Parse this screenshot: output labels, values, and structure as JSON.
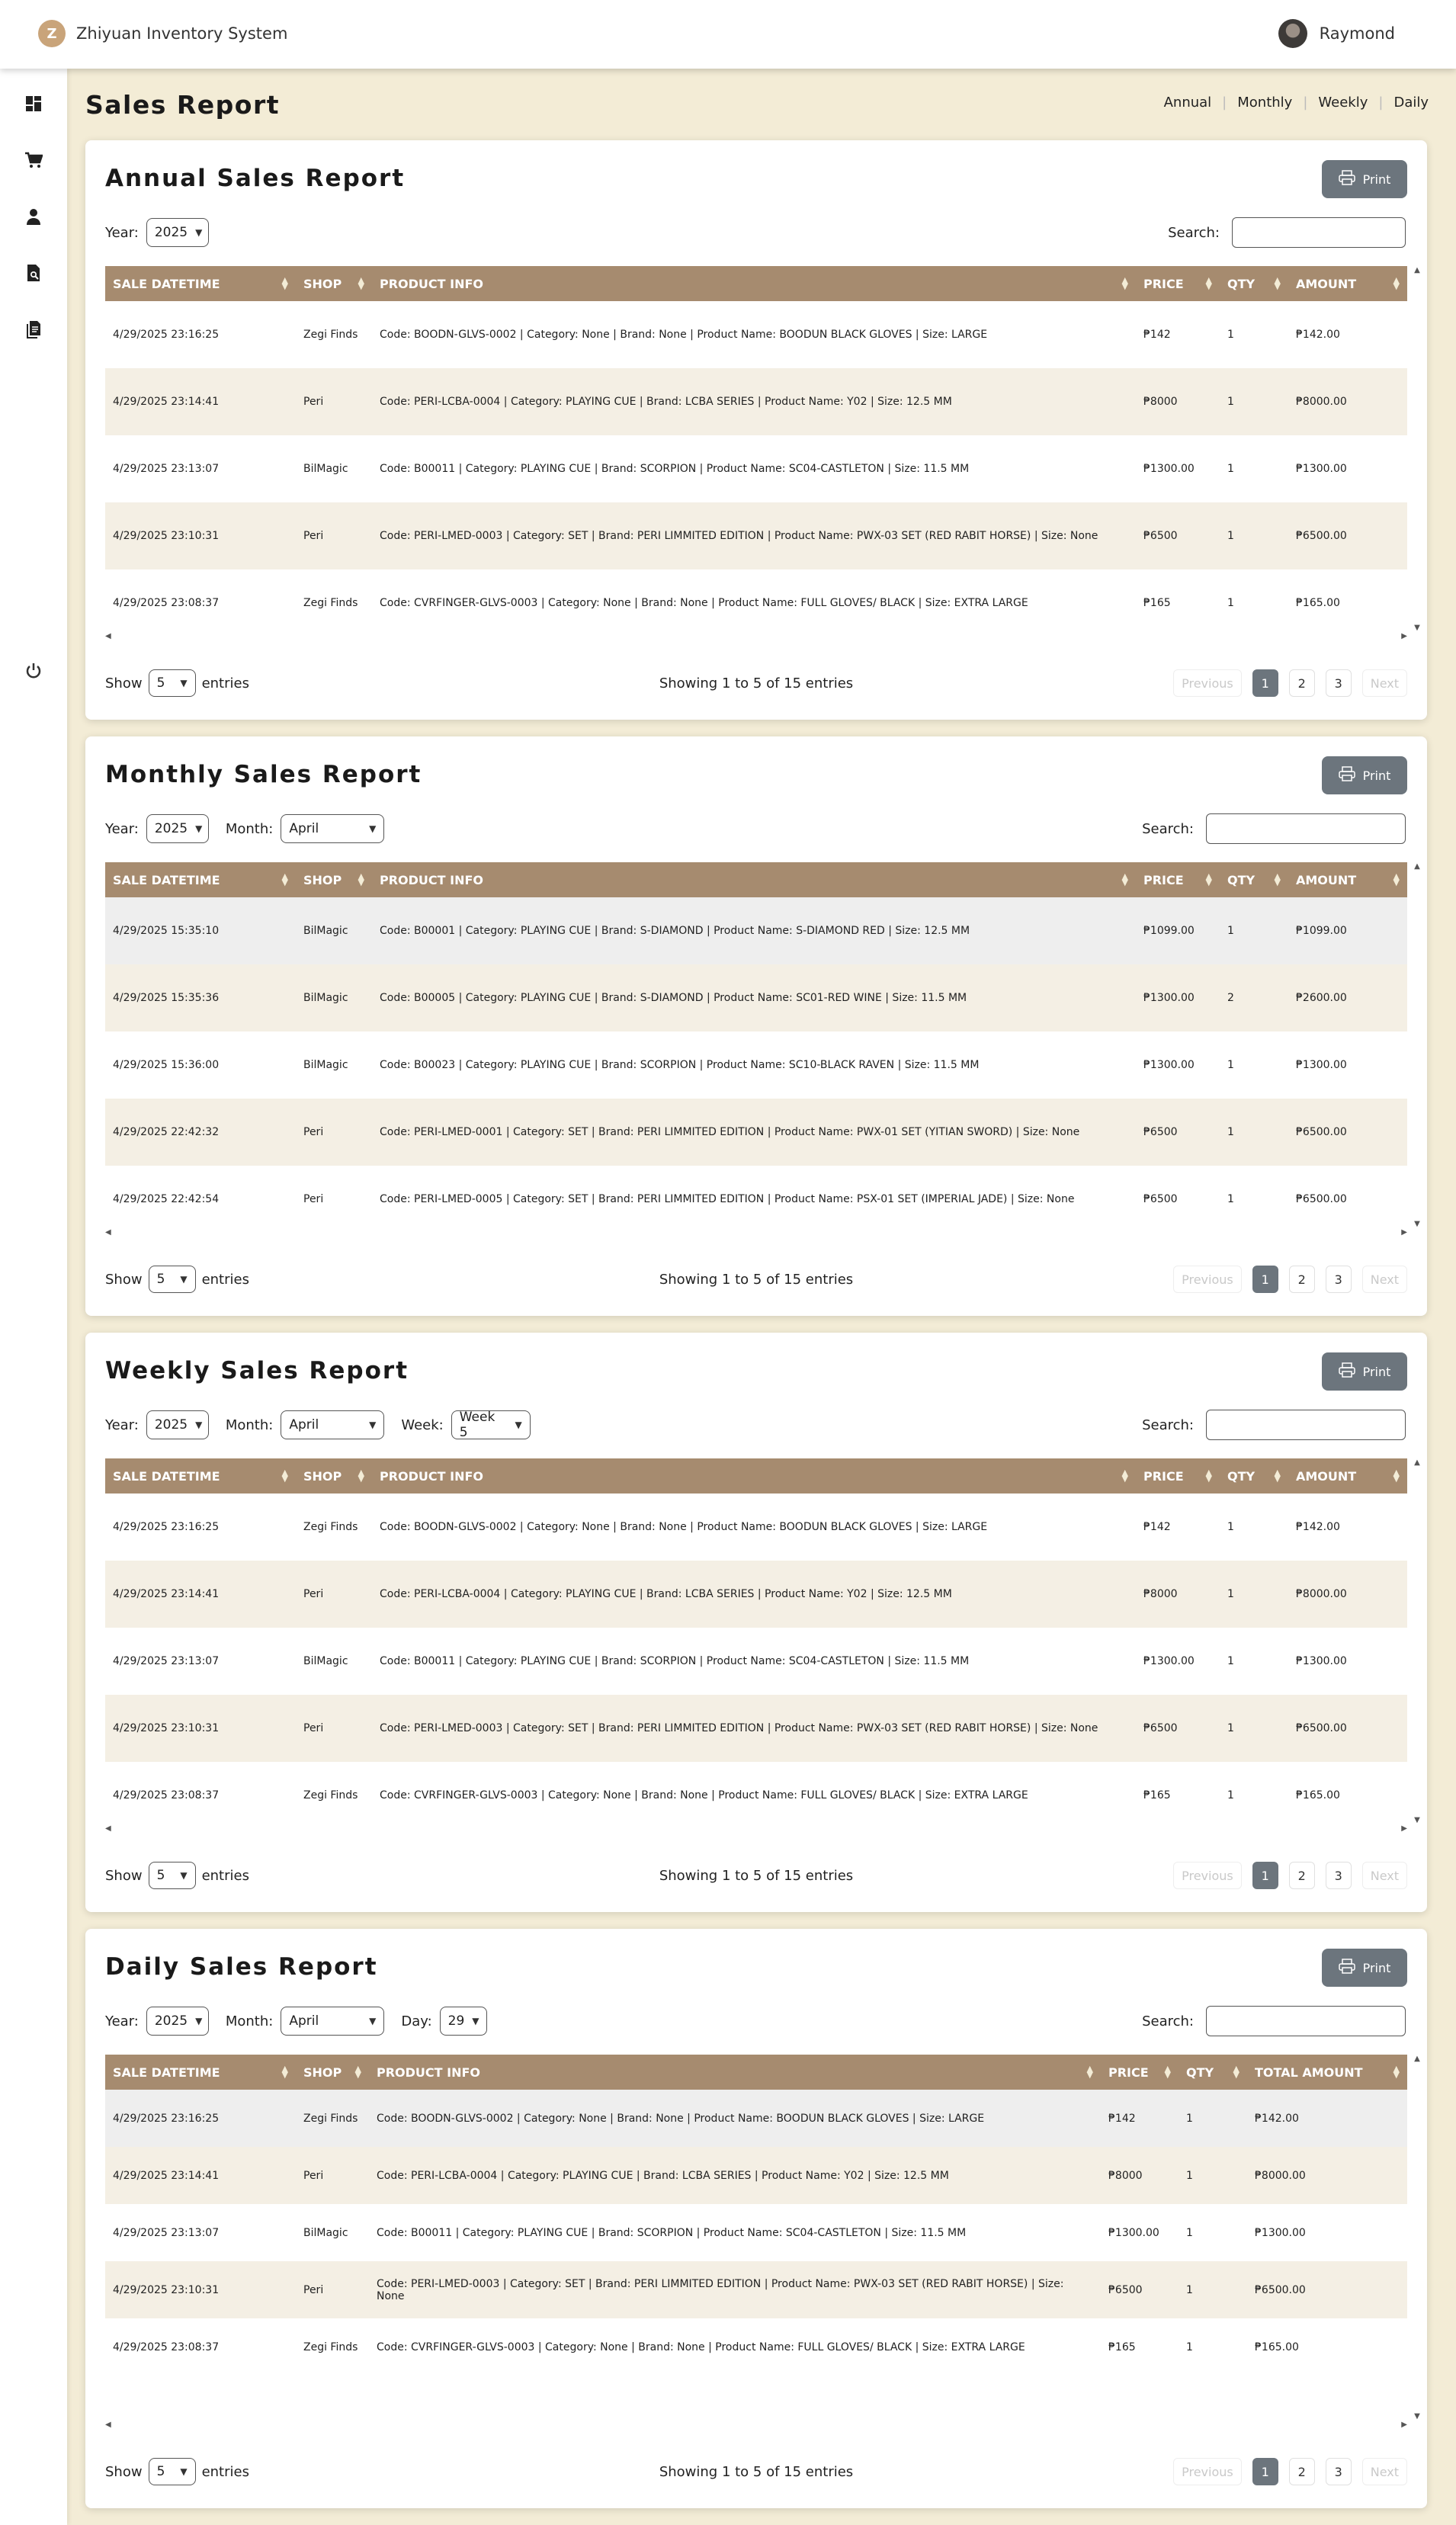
{
  "app": {
    "title": "Zhiyuan Inventory System",
    "logo_letter": "Z"
  },
  "user": {
    "name": "Raymond"
  },
  "sidebar": {
    "items": [
      {
        "name": "dashboard-icon"
      },
      {
        "name": "cart-icon"
      },
      {
        "name": "user-icon"
      },
      {
        "name": "report-search-icon"
      },
      {
        "name": "documents-icon"
      },
      {
        "name": "logout-icon"
      }
    ]
  },
  "page": {
    "title": "Sales Report"
  },
  "topnav": {
    "annual": "Annual",
    "monthly": "Monthly",
    "weekly": "Weekly",
    "daily": "Daily"
  },
  "common": {
    "print": "Print",
    "search_label": "Search:",
    "show": "Show",
    "entries": "entries",
    "previous": "Previous",
    "next": "Next",
    "page1": "1",
    "page2": "2",
    "page3": "3",
    "info": "Showing 1 to 5 of 15 entries",
    "year_label": "Year:",
    "month_label": "Month:",
    "week_label": "Week:",
    "day_label": "Day:",
    "year": "2025",
    "month": "April",
    "week": "Week 5",
    "day": "29",
    "page_size": "5"
  },
  "headers": {
    "datetime": "SALE DATETIME",
    "shop": "SHOP",
    "product": "PRODUCT INFO",
    "price": "PRICE",
    "qty": "QTY",
    "amount": "AMOUNT",
    "total_amount": "TOTAL AMOUNT"
  },
  "annual": {
    "title": "Annual Sales Report",
    "rows": [
      {
        "dt": "4/29/2025 23:16:25",
        "shop": "Zegi Finds",
        "info": "Code: BOODN-GLVS-0002 | Category: None | Brand: None | Product Name: BOODUN BLACK GLOVES | Size: LARGE",
        "price": "₱142",
        "qty": "1",
        "amount": "₱142.00"
      },
      {
        "dt": "4/29/2025 23:14:41",
        "shop": "Peri",
        "info": "Code: PERI-LCBA-0004 | Category: PLAYING CUE | Brand: LCBA SERIES | Product Name: Y02 | Size: 12.5 MM",
        "price": "₱8000",
        "qty": "1",
        "amount": "₱8000.00"
      },
      {
        "dt": "4/29/2025 23:13:07",
        "shop": "BilMagic",
        "info": "Code: B00011 | Category: PLAYING CUE | Brand: SCORPION | Product Name: SC04-CASTLETON | Size: 11.5 MM",
        "price": "₱1300.00",
        "qty": "1",
        "amount": "₱1300.00"
      },
      {
        "dt": "4/29/2025 23:10:31",
        "shop": "Peri",
        "info": "Code: PERI-LMED-0003 | Category: SET | Brand: PERI LIMMITED EDITION | Product Name: PWX-03 SET (RED RABIT HORSE) | Size: None",
        "price": "₱6500",
        "qty": "1",
        "amount": "₱6500.00"
      },
      {
        "dt": "4/29/2025 23:08:37",
        "shop": "Zegi Finds",
        "info": "Code: CVRFINGER-GLVS-0003 | Category: None | Brand: None | Product Name: FULL GLOVES/ BLACK | Size: EXTRA LARGE",
        "price": "₱165",
        "qty": "1",
        "amount": "₱165.00"
      }
    ]
  },
  "monthly": {
    "title": "Monthly Sales Report",
    "rows": [
      {
        "dt": "4/29/2025 15:35:10",
        "shop": "BilMagic",
        "info": "Code: B00001 | Category: PLAYING CUE | Brand: S-DIAMOND | Product Name: S-DIAMOND RED | Size: 12.5 MM",
        "price": "₱1099.00",
        "qty": "1",
        "amount": "₱1099.00"
      },
      {
        "dt": "4/29/2025 15:35:36",
        "shop": "BilMagic",
        "info": "Code: B00005 | Category: PLAYING CUE | Brand: S-DIAMOND | Product Name: SC01-RED WINE | Size: 11.5 MM",
        "price": "₱1300.00",
        "qty": "2",
        "amount": "₱2600.00"
      },
      {
        "dt": "4/29/2025 15:36:00",
        "shop": "BilMagic",
        "info": "Code: B00023 | Category: PLAYING CUE | Brand: SCORPION | Product Name: SC10-BLACK RAVEN | Size: 11.5 MM",
        "price": "₱1300.00",
        "qty": "1",
        "amount": "₱1300.00"
      },
      {
        "dt": "4/29/2025 22:42:32",
        "shop": "Peri",
        "info": "Code: PERI-LMED-0001 | Category: SET | Brand: PERI LIMMITED EDITION | Product Name: PWX-01 SET (YITIAN SWORD) | Size: None",
        "price": "₱6500",
        "qty": "1",
        "amount": "₱6500.00"
      },
      {
        "dt": "4/29/2025 22:42:54",
        "shop": "Peri",
        "info": "Code: PERI-LMED-0005 | Category: SET | Brand: PERI LIMMITED EDITION | Product Name: PSX-01 SET (IMPERIAL JADE) | Size: None",
        "price": "₱6500",
        "qty": "1",
        "amount": "₱6500.00"
      }
    ]
  },
  "weekly": {
    "title": "Weekly Sales Report",
    "rows": [
      {
        "dt": "4/29/2025 23:16:25",
        "shop": "Zegi Finds",
        "info": "Code: BOODN-GLVS-0002 | Category: None | Brand: None | Product Name: BOODUN BLACK GLOVES | Size: LARGE",
        "price": "₱142",
        "qty": "1",
        "amount": "₱142.00"
      },
      {
        "dt": "4/29/2025 23:14:41",
        "shop": "Peri",
        "info": "Code: PERI-LCBA-0004 | Category: PLAYING CUE | Brand: LCBA SERIES | Product Name: Y02 | Size: 12.5 MM",
        "price": "₱8000",
        "qty": "1",
        "amount": "₱8000.00"
      },
      {
        "dt": "4/29/2025 23:13:07",
        "shop": "BilMagic",
        "info": "Code: B00011 | Category: PLAYING CUE | Brand: SCORPION | Product Name: SC04-CASTLETON | Size: 11.5 MM",
        "price": "₱1300.00",
        "qty": "1",
        "amount": "₱1300.00"
      },
      {
        "dt": "4/29/2025 23:10:31",
        "shop": "Peri",
        "info": "Code: PERI-LMED-0003 | Category: SET | Brand: PERI LIMMITED EDITION | Product Name: PWX-03 SET (RED RABIT HORSE) | Size: None",
        "price": "₱6500",
        "qty": "1",
        "amount": "₱6500.00"
      },
      {
        "dt": "4/29/2025 23:08:37",
        "shop": "Zegi Finds",
        "info": "Code: CVRFINGER-GLVS-0003 | Category: None | Brand: None | Product Name: FULL GLOVES/ BLACK | Size: EXTRA LARGE",
        "price": "₱165",
        "qty": "1",
        "amount": "₱165.00"
      }
    ]
  },
  "daily": {
    "title": "Daily Sales Report",
    "rows": [
      {
        "dt": "4/29/2025 23:16:25",
        "shop": "Zegi Finds",
        "info": "Code: BOODN-GLVS-0002 | Category: None | Brand: None | Product Name: BOODUN BLACK GLOVES | Size: LARGE",
        "price": "₱142",
        "qty": "1",
        "amount": "₱142.00"
      },
      {
        "dt": "4/29/2025 23:14:41",
        "shop": "Peri",
        "info": "Code: PERI-LCBA-0004 | Category: PLAYING CUE | Brand: LCBA SERIES | Product Name: Y02 | Size: 12.5 MM",
        "price": "₱8000",
        "qty": "1",
        "amount": "₱8000.00"
      },
      {
        "dt": "4/29/2025 23:13:07",
        "shop": "BilMagic",
        "info": "Code: B00011 | Category: PLAYING CUE | Brand: SCORPION | Product Name: SC04-CASTLETON | Size: 11.5 MM",
        "price": "₱1300.00",
        "qty": "1",
        "amount": "₱1300.00"
      },
      {
        "dt": "4/29/2025 23:10:31",
        "shop": "Peri",
        "info": "Code: PERI-LMED-0003 | Category: SET | Brand: PERI LIMMITED EDITION | Product Name: PWX-03 SET (RED RABIT HORSE) | Size: None",
        "price": "₱6500",
        "qty": "1",
        "amount": "₱6500.00"
      },
      {
        "dt": "4/29/2025 23:08:37",
        "shop": "Zegi Finds",
        "info": "Code: CVRFINGER-GLVS-0003 | Category: None | Brand: None | Product Name: FULL GLOVES/ BLACK | Size: EXTRA LARGE",
        "price": "₱165",
        "qty": "1",
        "amount": "₱165.00"
      }
    ]
  }
}
